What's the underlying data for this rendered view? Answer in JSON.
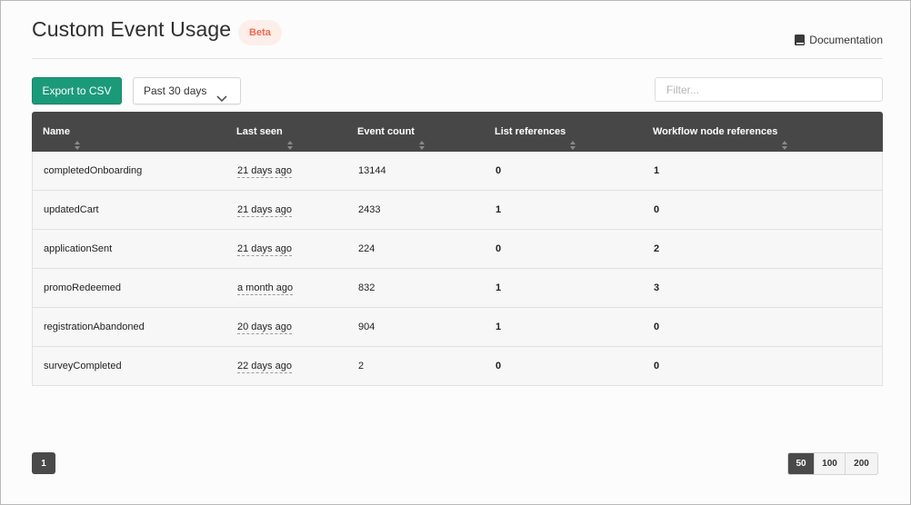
{
  "header": {
    "title": "Custom Event Usage",
    "badge": "Beta",
    "doc_link": "Documentation"
  },
  "toolbar": {
    "export_label": "Export to CSV",
    "range_value": "Past 30 days",
    "filter_placeholder": "Filter..."
  },
  "table": {
    "columns": [
      "Name",
      "Last seen",
      "Event count",
      "List references",
      "Workflow node references"
    ],
    "rows": [
      {
        "name": "completedOnboarding",
        "last_seen": "21 days ago",
        "event_count": "13144",
        "list_refs": "0",
        "workflow_refs": "1"
      },
      {
        "name": "updatedCart",
        "last_seen": "21 days ago",
        "event_count": "2433",
        "list_refs": "1",
        "workflow_refs": "0"
      },
      {
        "name": "applicationSent",
        "last_seen": "21 days ago",
        "event_count": "224",
        "list_refs": "0",
        "workflow_refs": "2"
      },
      {
        "name": "promoRedeemed",
        "last_seen": "a month ago",
        "event_count": "832",
        "list_refs": "1",
        "workflow_refs": "3"
      },
      {
        "name": "registrationAbandoned",
        "last_seen": "20 days ago",
        "event_count": "904",
        "list_refs": "1",
        "workflow_refs": "0"
      },
      {
        "name": "surveyCompleted",
        "last_seen": "22 days ago",
        "event_count": "2",
        "list_refs": "0",
        "workflow_refs": "0"
      }
    ]
  },
  "pagination": {
    "current_page": "1",
    "page_sizes": [
      "50",
      "100",
      "200"
    ],
    "selected_size": "50"
  },
  "colors": {
    "accent": "#1b9a7a",
    "header_bg": "#474747",
    "badge_text": "#f06a50",
    "badge_bg": "#fdeeea"
  },
  "icons": {
    "doc": "book-icon",
    "dropdown": "chevron-down-icon",
    "sort": "sort-icon"
  }
}
